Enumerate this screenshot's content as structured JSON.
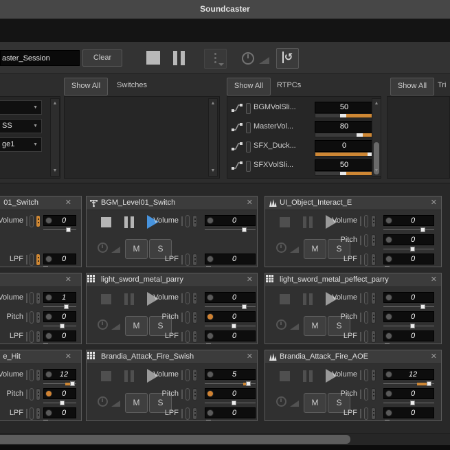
{
  "window": {
    "title": "Soundcaster"
  },
  "icons": {
    "close": "✕",
    "up": "▲",
    "down": "▼",
    "dropdown": "▼",
    "reset": "↺"
  },
  "colors": {
    "accent_orange": "#CE8734",
    "play_blue": "#4793DD",
    "handle_white": "#EDEDED"
  },
  "toolbar": {
    "session_value": "aster_Session",
    "clear_label": "Clear"
  },
  "sync_header": {
    "show_all": "Show All",
    "switches_label": "Switches",
    "rtpcs_label": "RTPCs",
    "triggers_label": "Tri"
  },
  "states_panel": {
    "dropdowns": [
      {
        "text": ""
      },
      {
        "text": "SS"
      },
      {
        "text": "ge1"
      }
    ]
  },
  "rtpcs": {
    "rows": [
      {
        "name": "BGMVolSli...",
        "value": "50",
        "handle": 48,
        "fill": [
          52,
          100
        ]
      },
      {
        "name": "MasterVol...",
        "value": "80",
        "handle": 76,
        "fill": [
          80,
          100
        ]
      },
      {
        "name": "SFX_Duck...",
        "value": "0",
        "handle": 95,
        "fill": [
          0,
          93
        ]
      },
      {
        "name": "SFXVolSli...",
        "value": "50",
        "handle": 48,
        "fill": [
          52,
          100
        ]
      }
    ]
  },
  "module_ui": {
    "mute": "M",
    "solo": "S"
  },
  "modules": [
    {
      "title": "01_Switch",
      "state": "",
      "params": [
        {
          "name": "Volume",
          "value": "0",
          "knob": "",
          "fader": "orange",
          "handle": 78,
          "fill": null
        },
        {
          "name": "LPF",
          "value": "0",
          "knob": "",
          "fader": "orange",
          "handle": 8,
          "fill": null
        }
      ]
    },
    {
      "title": "BGM_Level01_Switch",
      "state": "playing",
      "params": [
        {
          "name": "Volume",
          "value": "0",
          "knob": "",
          "fader": "",
          "handle": 78,
          "fill": null
        },
        {
          "name": "LPF",
          "value": "0",
          "knob": "",
          "fader": "",
          "handle": 8,
          "fill": null
        }
      ]
    },
    {
      "title": "UI_Object_Interact_E",
      "state": "",
      "params": [
        {
          "name": "Volume",
          "value": "0",
          "knob": "",
          "fader": "",
          "handle": 78,
          "fill": null
        },
        {
          "name": "Pitch",
          "value": "0",
          "knob": "",
          "fader": "",
          "handle": 58,
          "fill": null
        },
        {
          "name": "LPF",
          "value": "0",
          "knob": "",
          "fader": "",
          "handle": 8,
          "fill": null
        }
      ]
    },
    {
      "title": "",
      "state": "",
      "params": [
        {
          "name": "Volume",
          "value": "1",
          "knob": "",
          "fader": "",
          "handle": 70,
          "fill": [
            62,
            70
          ]
        },
        {
          "name": "Pitch",
          "value": "0",
          "knob": "",
          "fader": "",
          "handle": 58,
          "fill": null
        },
        {
          "name": "LPF",
          "value": "0",
          "knob": "",
          "fader": "",
          "handle": 8,
          "fill": null
        }
      ]
    },
    {
      "title": "light_sword_metal_parry",
      "state": "",
      "params": [
        {
          "name": "Volume",
          "value": "0",
          "knob": "",
          "fader": "",
          "handle": 78,
          "fill": null
        },
        {
          "name": "Pitch",
          "value": "0",
          "knob": "orange",
          "fader": "",
          "handle": 58,
          "fill": null
        },
        {
          "name": "LPF",
          "value": "0",
          "knob": "",
          "fader": "",
          "handle": 8,
          "fill": null
        }
      ]
    },
    {
      "title": "light_sword_metal_peffect_parry",
      "state": "",
      "params": [
        {
          "name": "Volume",
          "value": "0",
          "knob": "",
          "fader": "",
          "handle": 78,
          "fill": null
        },
        {
          "name": "Pitch",
          "value": "0",
          "knob": "",
          "fader": "",
          "handle": 58,
          "fill": null
        },
        {
          "name": "LPF",
          "value": "0",
          "knob": "",
          "fader": "",
          "handle": 8,
          "fill": null
        }
      ]
    },
    {
      "title": "e_Hit",
      "state": "",
      "params": [
        {
          "name": "Volume",
          "value": "12",
          "knob": "",
          "fader": "",
          "handle": 90,
          "fill": [
            66,
            90
          ]
        },
        {
          "name": "Pitch",
          "value": "0",
          "knob": "orange",
          "fader": "",
          "handle": 58,
          "fill": null
        },
        {
          "name": "LPF",
          "value": "0",
          "knob": "",
          "fader": "",
          "handle": 8,
          "fill": null
        }
      ]
    },
    {
      "title": "Brandia_Attack_Fire_Swish",
      "state": "",
      "params": [
        {
          "name": "Volume",
          "value": "5",
          "knob": "",
          "fader": "",
          "handle": 87,
          "fill": [
            75,
            87
          ]
        },
        {
          "name": "Pitch",
          "value": "0",
          "knob": "orange",
          "fader": "",
          "handle": 58,
          "fill": null
        },
        {
          "name": "LPF",
          "value": "0",
          "knob": "",
          "fader": "",
          "handle": 8,
          "fill": null
        }
      ]
    },
    {
      "title": "Brandia_Attack_Fire_AOE",
      "state": "",
      "params": [
        {
          "name": "Volume",
          "value": "12",
          "knob": "",
          "fader": "",
          "handle": 90,
          "fill": [
            66,
            90
          ]
        },
        {
          "name": "Pitch",
          "value": "0",
          "knob": "",
          "fader": "",
          "handle": 58,
          "fill": null
        },
        {
          "name": "LPF",
          "value": "0",
          "knob": "",
          "fader": "",
          "handle": 8,
          "fill": null
        }
      ]
    }
  ]
}
